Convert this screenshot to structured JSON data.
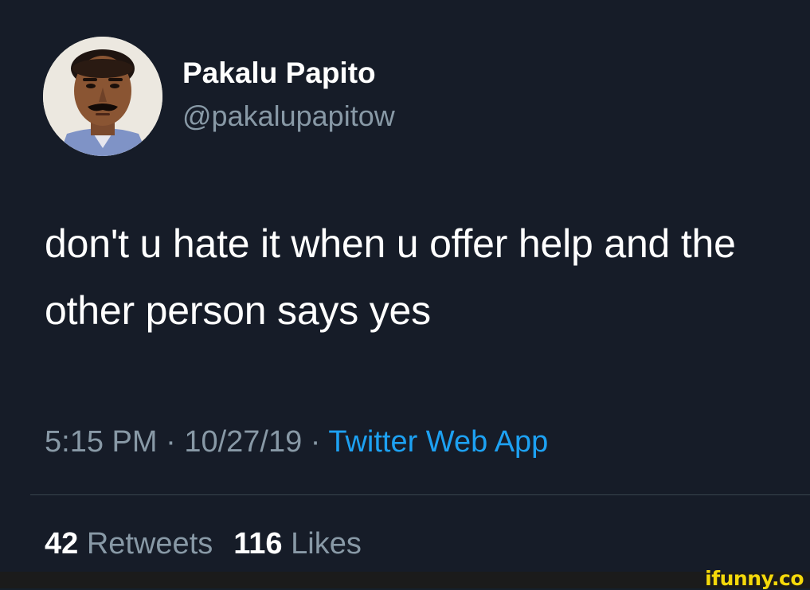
{
  "author": {
    "display_name": "Pakalu Papito",
    "handle": "@pakalupapitow"
  },
  "tweet": {
    "text": "don't u hate it when u offer help and the other person says yes",
    "time": "5:15 PM",
    "date": "10/27/19",
    "separator": "·",
    "source": "Twitter Web App"
  },
  "stats": {
    "retweets_count": "42",
    "retweets_label": "Retweets",
    "likes_count": "116",
    "likes_label": "Likes"
  },
  "watermark": "ifunny.co",
  "colors": {
    "background": "#161c28",
    "text_primary": "#ffffff",
    "text_secondary": "#8899a6",
    "link": "#1da1f2",
    "watermark": "#f5d90a"
  }
}
